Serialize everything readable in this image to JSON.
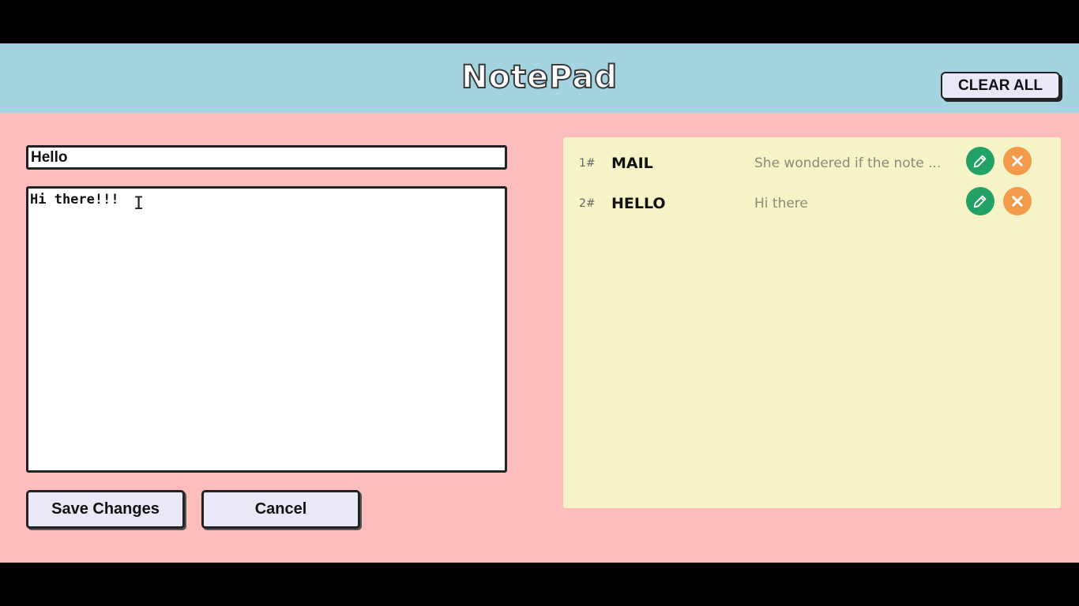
{
  "header": {
    "title": "NotePad",
    "clear_all_label": "CLEAR ALL"
  },
  "editor": {
    "title_value": "Hello",
    "body_value": "Hi there!!!",
    "save_label": "Save Changes",
    "cancel_label": "Cancel"
  },
  "notes": [
    {
      "number": "1#",
      "title": "MAIL",
      "preview": "She wondered if the note ..."
    },
    {
      "number": "2#",
      "title": "HELLO",
      "preview": "Hi there"
    }
  ],
  "icons": {
    "edit": "pencil-icon",
    "delete": "close-icon"
  },
  "colors": {
    "header_bg": "#a4d4e0",
    "app_bg": "#fdbdbd",
    "notes_bg": "#f6f4c6",
    "edit_green": "#22a266",
    "delete_orange": "#f39b4b"
  }
}
